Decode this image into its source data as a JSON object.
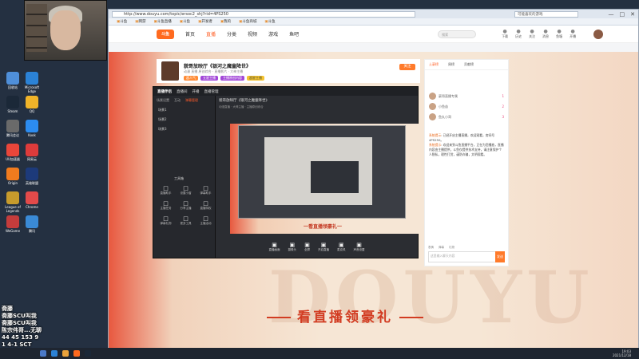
{
  "browser": {
    "url": "http://www.douyu.com/topic/ersoc2_shj?rid=4PS250",
    "search_placeholder": "可能喜欢的游戏",
    "bookmarks": [
      "斗鱼",
      "网游",
      "斗鱼直播",
      "斗鱼",
      "开发者",
      "我的",
      "斗鱼商城",
      "斗鱼",
      "斗鱼",
      "斗鱼"
    ]
  },
  "site": {
    "logo": "斗鱼",
    "nav": [
      "首页",
      "直播",
      "分类",
      "视频",
      "游戏",
      "鱼吧"
    ],
    "search_placeholder": "搜索",
    "header_icons": [
      "下载",
      "历史",
      "关注",
      "消息",
      "鱼塘",
      "开播"
    ]
  },
  "stream": {
    "title": "貌哥放映厅《银河之魔童降世》",
    "meta": "动漫   直播   原创综合 · 直播影片 · 大神主播",
    "tags": [
      "超人气",
      "五星主播",
      "主播原创内容",
      "超星主播"
    ],
    "follow_label": "关注"
  },
  "embed_app": {
    "brand": "直播伴侣",
    "menu": [
      "直播间",
      "开播",
      "直播管理"
    ],
    "tabs": [
      "场景设置",
      "互动",
      "弹幕管理"
    ],
    "scenes": [
      "场景1",
      "场景2",
      "场景3"
    ],
    "stream_title": "貌哥放映厅《银河之魔童降世》",
    "stream_sub": "动漫直播 · 大神主播 · 主播原创综合",
    "tools_title": "工具箱",
    "tools": [
      "直播助手",
      "设置小窗",
      "弹幕助手",
      "主播任务",
      "分享主播",
      "直播特权",
      "弹幕礼物",
      "更多工具",
      "主播活动"
    ],
    "preview_text": "一看直播领豪礼一",
    "controls": [
      "直播画面",
      "摄像头",
      "全屏",
      "开启直播",
      "麦克风",
      "声音设置"
    ]
  },
  "chat": {
    "rank_tabs": [
      "土豪榜",
      "周榜",
      "贡献榜"
    ],
    "ranks": [
      {
        "name": "豪哥直播专属",
        "value": "1"
      },
      {
        "name": "小鱼苗",
        "value": "2"
      },
      {
        "name": "鱼丸小哥",
        "value": "3"
      }
    ],
    "messages": [
      {
        "user": "系统提示",
        "text": "已经开启主播直播，欢迎观看，房间号4PS250。"
      },
      {
        "user": "系统提示",
        "text": "欢迎来到斗鱼直播平台，正在为您播放，直播内容由主播提供，斗鱼仅提供技术支持，请注意保护个人隐私，理性打赏，谨防诈骗，文明观看。"
      }
    ],
    "tools": [
      "表情",
      "弹幕",
      "礼物"
    ],
    "input_placeholder": "这里输入聊天内容",
    "send_label": "发送"
  },
  "promo": "看直播领豪礼",
  "bg_letters": "DOUYU",
  "overlay_chat": [
    "斋藤",
    "斋藤SCU叫我",
    "斋藤SCU叫我",
    "陈宗伟哥...无聊",
    "44 45 153 9",
    "1 4-1 SCT"
  ],
  "taskbar": {
    "time": "19:03",
    "date": "2021/12/18"
  },
  "desktop_icons": [
    "回收站",
    "Microsoft Edge",
    "Steam",
    "QQ",
    "Kook",
    "腾讯会议",
    "UU加速器",
    "网易云",
    "Origin",
    "英雄联盟",
    "League of Legends",
    "WeGame",
    "腾讯",
    "Chrome"
  ]
}
